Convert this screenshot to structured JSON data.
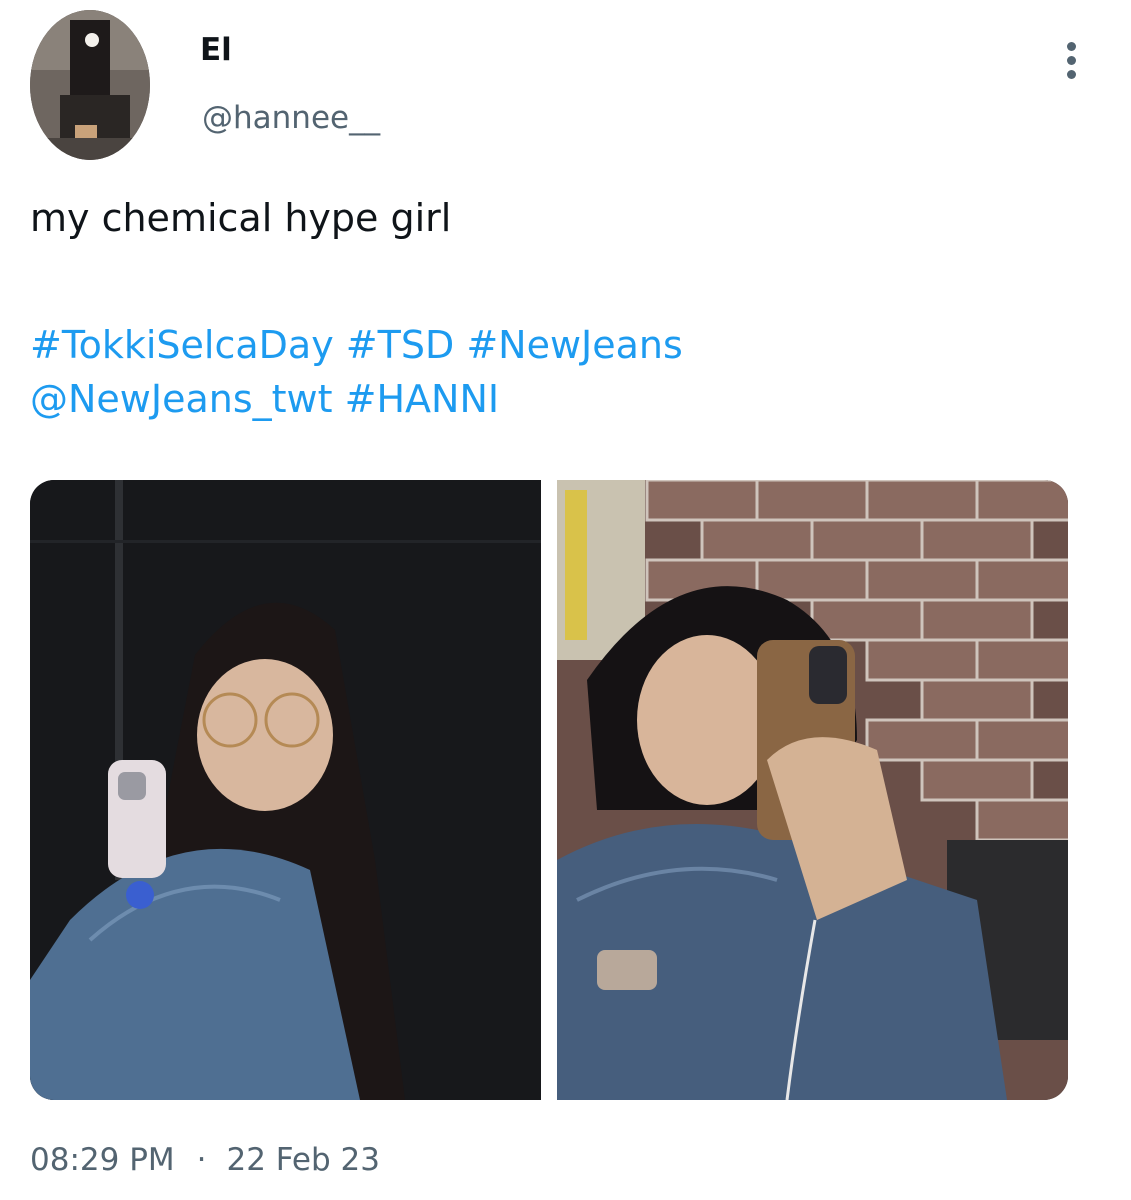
{
  "tweet": {
    "author": {
      "display_name": "El",
      "handle": "@hannee__"
    },
    "text": "my chemical hype girl",
    "tags": {
      "line1": [
        "#TokkiSelcaDay",
        "#TSD",
        "#NewJeans"
      ],
      "line2": [
        "@NewJeans_twt",
        "#HANNI"
      ]
    },
    "media": [
      {
        "label": "Mirror selfie with phone, denim jacket"
      },
      {
        "label": "Mirror selfie with phone in front of brick wall"
      }
    ],
    "time": "08:29 PM",
    "separator": "·",
    "date": "22 Feb 23"
  },
  "icons": {
    "more": "more-vertical-icon"
  },
  "colors": {
    "link": "#1d9bf0",
    "secondary_text": "#536471",
    "primary_text": "#0f1419"
  }
}
